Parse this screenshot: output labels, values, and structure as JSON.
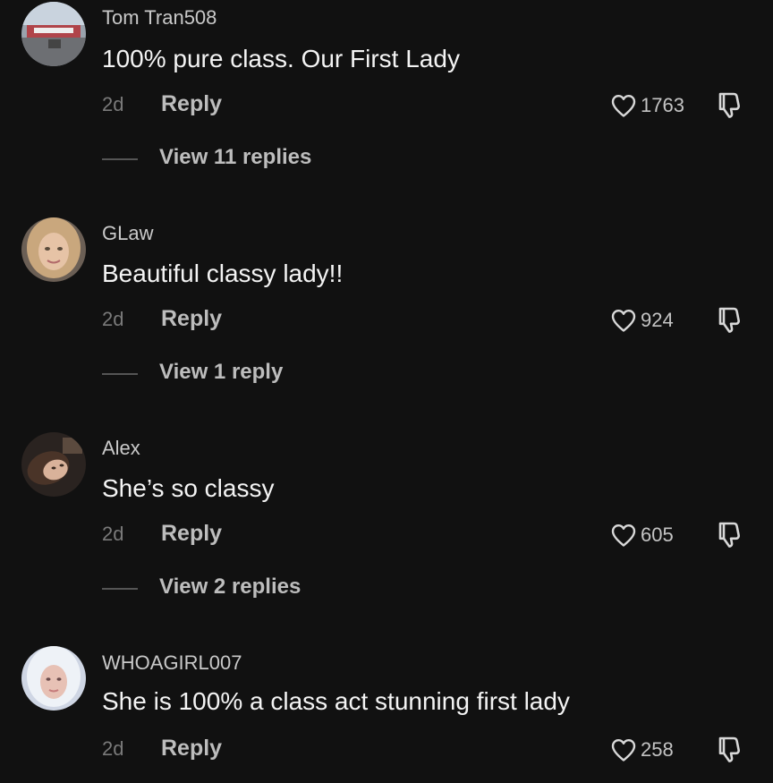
{
  "comments": [
    {
      "username": "Tom Tran508",
      "text": "100% pure class. Our First Lady",
      "time": "2d",
      "reply_label": "Reply",
      "likes": "1763",
      "view_replies": "View 11 replies"
    },
    {
      "username": "GLaw",
      "text": "Beautiful classy lady!!",
      "time": "2d",
      "reply_label": "Reply",
      "likes": "924",
      "view_replies": "View 1 reply"
    },
    {
      "username": "Alex",
      "text": "She’s so classy",
      "time": "2d",
      "reply_label": "Reply",
      "likes": "605",
      "view_replies": "View 2 replies"
    },
    {
      "username": "WHOAGIRL007",
      "text": "She is 100% a class act stunning first lady",
      "time": "2d",
      "reply_label": "Reply",
      "likes": "258"
    }
  ],
  "icons": {
    "like": "heart-icon",
    "dislike": "thumbs-down-icon"
  },
  "colors": {
    "background": "#111111",
    "text_primary": "#f4f4f4",
    "text_secondary": "#bdbdbd",
    "text_muted": "#7a7a7a"
  }
}
